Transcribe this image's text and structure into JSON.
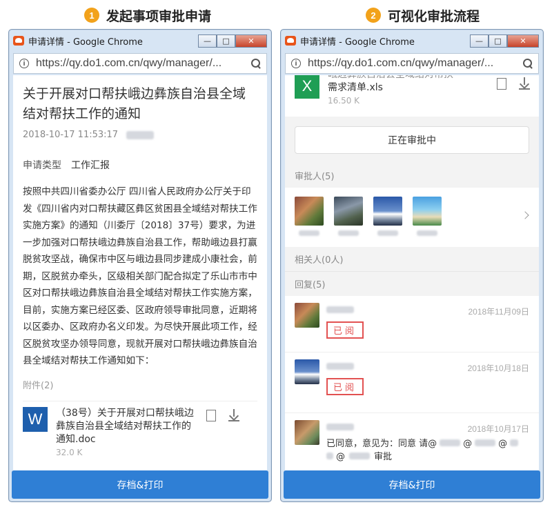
{
  "heading_left": {
    "number": "1",
    "text": "发起事项审批申请"
  },
  "heading_right": {
    "number": "2",
    "text": "可视化审批流程"
  },
  "window": {
    "title": "申请详情 - Google Chrome",
    "url": "https://qy.do1.com.cn/qwy/manager/...",
    "close_glyph": "✕",
    "max_glyph": "□",
    "min_glyph": "—"
  },
  "left": {
    "title": "关于开展对口帮扶峨边彝族自治县全域结对帮扶工作的通知",
    "date": "2018-10-17 11:53:17",
    "type_label": "申请类型",
    "type_value": "工作汇报",
    "body": "按照中共四川省委办公厅 四川省人民政府办公厅关于印发《四川省内对口帮扶藏区彝区贫困县全域结对帮扶工作实施方案》的通知（川委厅〔2018〕37号）要求，为进一步加强对口帮扶峨边彝族自治县工作，帮助峨边县打赢脱贫攻坚战，确保市中区与峨边县同步建成小康社会，前期，区脱贫办牵头，区级相关部门配合拟定了乐山市市中区对口帮扶峨边彝族自治县全域结对帮扶工作实施方案，目前，实施方案已经区委、区政府领导审批同意，近期将以区委办、区政府办名义印发。为尽快开展此项工作，经区脱贫攻坚办领导同意，现就开展对口帮扶峨边彝族自治县全域结对帮扶工作通知如下：",
    "attachments_label": "附件(2)",
    "attachment": {
      "icon": "W",
      "name": "（38号）关于开展对口帮扶峨边彝族自治县全域结对帮扶工作的通知.doc",
      "size": "32.0 K"
    },
    "button": "存档&打印"
  },
  "right": {
    "top_file": {
      "icon": "X",
      "name_cut": "峨边彝族自治县全域结对帮扶",
      "name": "需求清单.xls",
      "size": "16.50 K"
    },
    "status": "正在审批中",
    "approvers_label": "审批人(5)",
    "related_label": "相关人(0人)",
    "replies_label": "回复(5)",
    "replies": [
      {
        "date": "2018年11月09日",
        "stamp": "已阅"
      },
      {
        "date": "2018年10月18日",
        "stamp": "已阅"
      },
      {
        "date": "2018年10月17日",
        "text_a": "已同意，意见为：同意 请@",
        "text_b": "@",
        "text_c": "@",
        "text_d": "审批"
      }
    ],
    "button": "存档&打印"
  }
}
